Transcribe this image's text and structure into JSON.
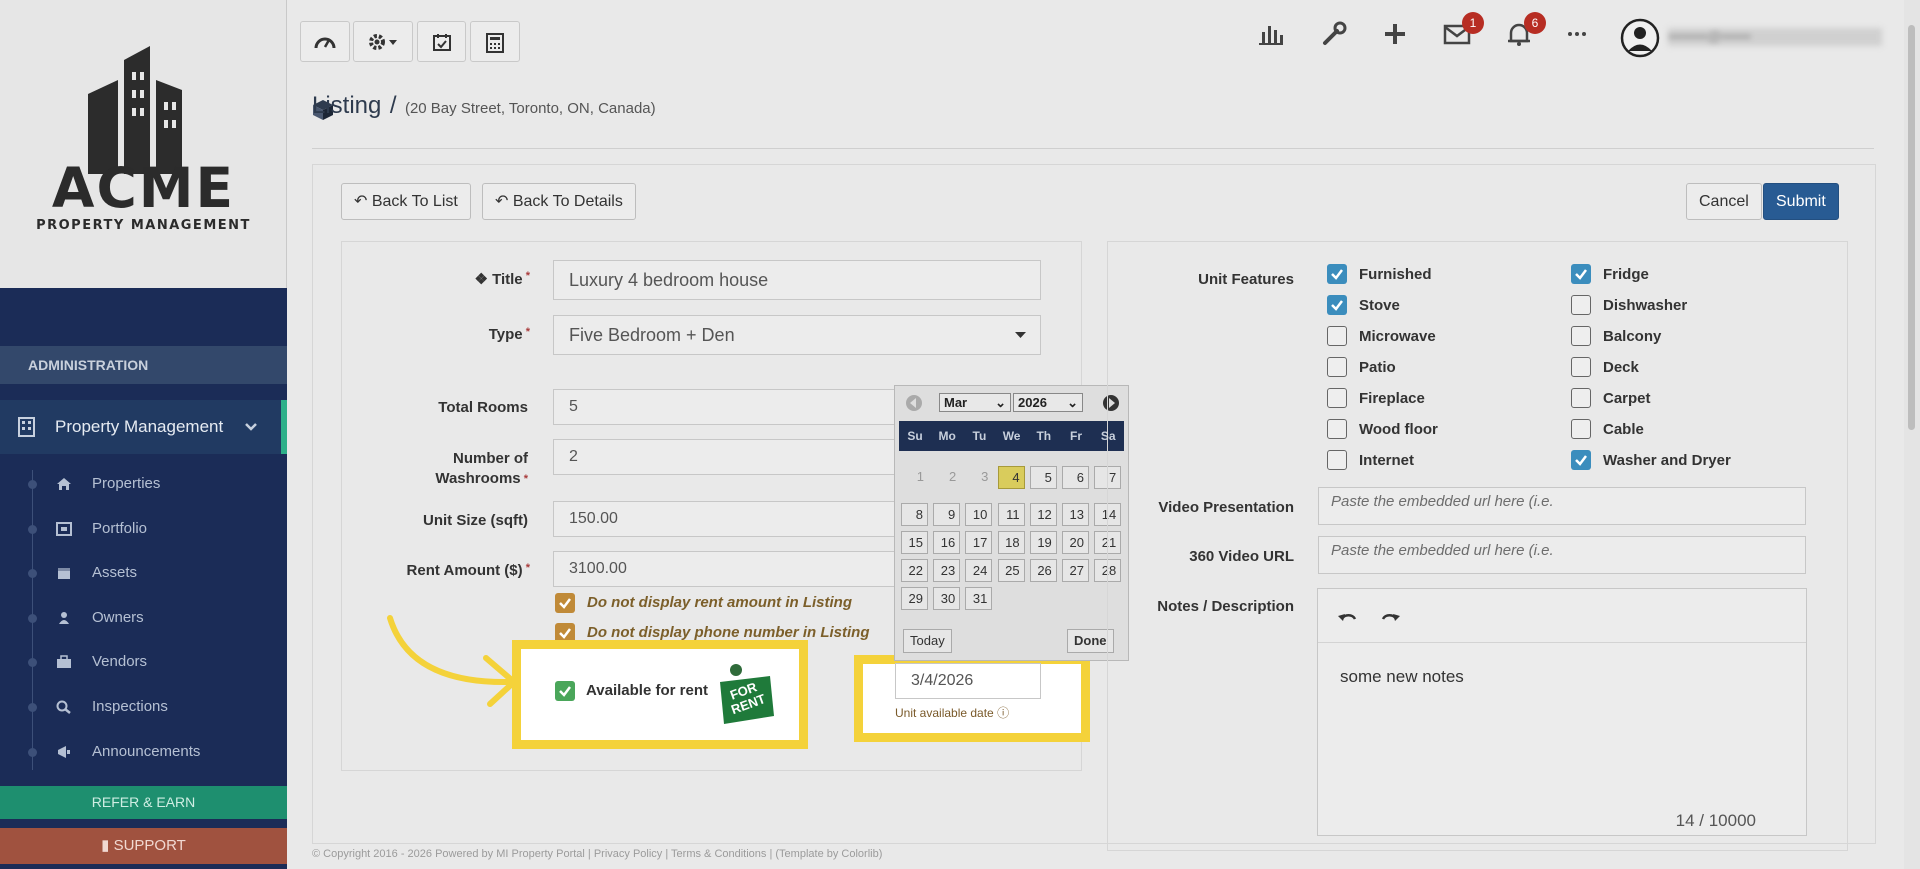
{
  "sidebar": {
    "logo_title": "ACME",
    "logo_subtitle": "PROPERTY MANAGEMENT",
    "section_label": "ADMINISTRATION",
    "group_label": "Property Management",
    "items": [
      {
        "label": "Properties",
        "icon": "home-icon"
      },
      {
        "label": "Portfolio",
        "icon": "portfolio-icon"
      },
      {
        "label": "Assets",
        "icon": "assets-icon"
      },
      {
        "label": "Owners",
        "icon": "user-icon"
      },
      {
        "label": "Vendors",
        "icon": "briefcase-icon"
      },
      {
        "label": "Inspections",
        "icon": "magnify-icon"
      },
      {
        "label": "Announcements",
        "icon": "bullhorn-icon"
      }
    ],
    "refer_label": "REFER & EARN",
    "support_label": "SUPPORT"
  },
  "topbar": {
    "mail_count": "1",
    "notification_count": "6",
    "user_name": "••••••••@••••••"
  },
  "page": {
    "title": "Listing",
    "separator": "/",
    "address": "(20 Bay Street, Toronto, ON, Canada)",
    "back_to_list": "Back To List",
    "back_to_details": "Back To Details",
    "cancel": "Cancel",
    "submit": "Submit"
  },
  "form": {
    "title_label": "Title",
    "title_value": "Luxury 4 bedroom house",
    "type_label": "Type",
    "type_value": "Five Bedroom + Den",
    "total_rooms_label": "Total Rooms",
    "total_rooms_value": "5",
    "washrooms_label_1": "Number of",
    "washrooms_label_2": "Washrooms",
    "washrooms_value": "2",
    "unit_size_label": "Unit Size (sqft)",
    "unit_size_value": "150.00",
    "rent_label": "Rent Amount ($)",
    "rent_value": "3100.00",
    "hide_rent_label": "Do not display rent amount in Listing",
    "hide_phone_label": "Do not display phone number in Listing",
    "available_label": "Available for rent",
    "for_rent_sign_1": "FOR",
    "for_rent_sign_2": "RENT",
    "date_value": "3/4/2026",
    "date_help": "Unit available date"
  },
  "calendar": {
    "month": "Mar",
    "year": "2026",
    "weekdays": [
      "Su",
      "Mo",
      "Tu",
      "We",
      "Th",
      "Fr",
      "Sa"
    ],
    "today_label": "Today",
    "done_label": "Done",
    "prev_days": [
      "1",
      "2",
      "3"
    ],
    "days": [
      "4",
      "5",
      "6",
      "7",
      "8",
      "9",
      "10",
      "11",
      "12",
      "13",
      "14",
      "15",
      "16",
      "17",
      "18",
      "19",
      "20",
      "21",
      "22",
      "23",
      "24",
      "25",
      "26",
      "27",
      "28",
      "29",
      "30",
      "31"
    ]
  },
  "features": {
    "label": "Unit Features",
    "left": [
      {
        "label": "Furnished",
        "checked": true
      },
      {
        "label": "Stove",
        "checked": true
      },
      {
        "label": "Microwave",
        "checked": false
      },
      {
        "label": "Patio",
        "checked": false
      },
      {
        "label": "Fireplace",
        "checked": false
      },
      {
        "label": "Wood floor",
        "checked": false
      },
      {
        "label": "Internet",
        "checked": false
      }
    ],
    "right": [
      {
        "label": "Fridge",
        "checked": true
      },
      {
        "label": "Dishwasher",
        "checked": false
      },
      {
        "label": "Balcony",
        "checked": false
      },
      {
        "label": "Deck",
        "checked": false
      },
      {
        "label": "Carpet",
        "checked": false
      },
      {
        "label": "Cable",
        "checked": false
      },
      {
        "label": "Washer and Dryer",
        "checked": true
      }
    ]
  },
  "media": {
    "video_label": "Video Presentation",
    "video_placeholder": "Paste the embedded url here (i.e.",
    "video360_label": "360 Video URL",
    "video360_placeholder": "Paste the embedded url here (i.e.",
    "notes_label": "Notes / Description",
    "notes_value": "some new notes",
    "char_count": "14 / 10000"
  },
  "footer": {
    "text": "© Copyright 2016 - 2026 Powered by MI Property Portal | Privacy Policy | Terms & Conditions | (Template by Colorlib)"
  },
  "colors": {
    "sidebar": "#1b2c57",
    "accent_green": "#2db089",
    "submit_blue": "#285b93",
    "highlight_yellow": "#f4d23a"
  }
}
